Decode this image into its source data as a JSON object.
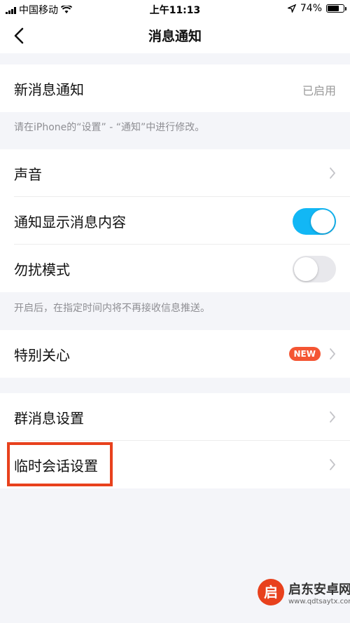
{
  "status_bar": {
    "carrier": "中国移动",
    "time": "上午11:13",
    "battery_text": "74%",
    "battery_level": 0.74,
    "icons": [
      "signal-icon",
      "wifi-icon",
      "location-icon",
      "battery-icon"
    ]
  },
  "nav": {
    "title": "消息通知",
    "back_icon": "chevron-left-icon"
  },
  "rows": {
    "new_message": {
      "label": "新消息通知",
      "value": "已启用"
    },
    "hint_1": "请在iPhone的“设置” - “通知”中进行修改。",
    "sound": {
      "label": "声音"
    },
    "show_content": {
      "label": "通知显示消息内容",
      "toggle_on": true
    },
    "dnd": {
      "label": "勿扰模式",
      "toggle_on": false
    },
    "hint_2": "开启后，在指定时间内将不再接收信息推送。",
    "special_care": {
      "label": "特别关心",
      "badge": "NEW"
    },
    "group_settings": {
      "label": "群消息设置"
    },
    "temp_chat": {
      "label": "临时会话设置"
    }
  },
  "watermark": {
    "title": "启东安卓网",
    "url": "www.qdtsaytx.com"
  },
  "colors": {
    "accent": "#12b7f5",
    "badge": "#f45533",
    "highlight": "#e8411d",
    "background": "#f4f5f9"
  }
}
